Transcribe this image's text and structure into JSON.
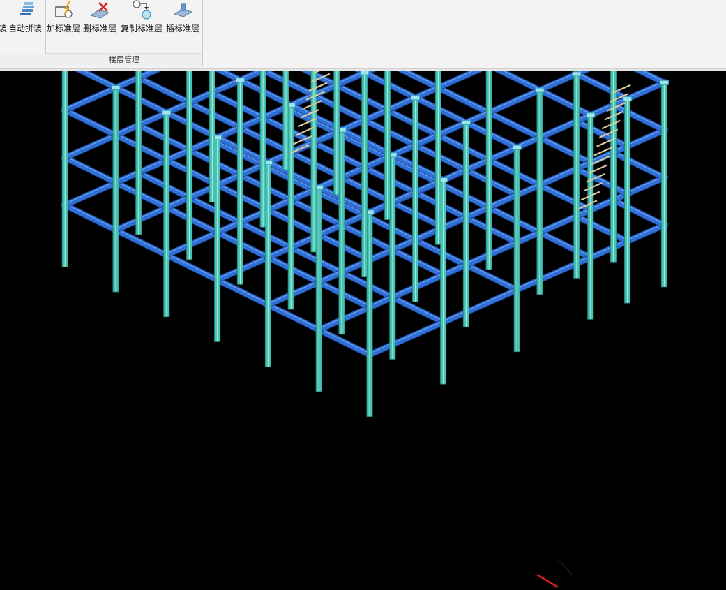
{
  "ribbon": {
    "partial_left_label": "装",
    "auto_assemble_label": "自动拼装",
    "group_label": "楼层管理",
    "tools": [
      {
        "label": "加标准层",
        "icon": "add-floor-icon"
      },
      {
        "label": "删标准层",
        "icon": "delete-floor-icon"
      },
      {
        "label": "复制标准层",
        "icon": "copy-floor-icon"
      },
      {
        "label": "插标准层",
        "icon": "insert-floor-icon"
      }
    ]
  },
  "viewport": {
    "background": "#000000",
    "beam_color": "#2f6fd6",
    "column_color": "#49c2b4",
    "stair_color": "#d9c9a3",
    "axis_color": "#d42020",
    "description_icon": "3d-frame-model"
  }
}
